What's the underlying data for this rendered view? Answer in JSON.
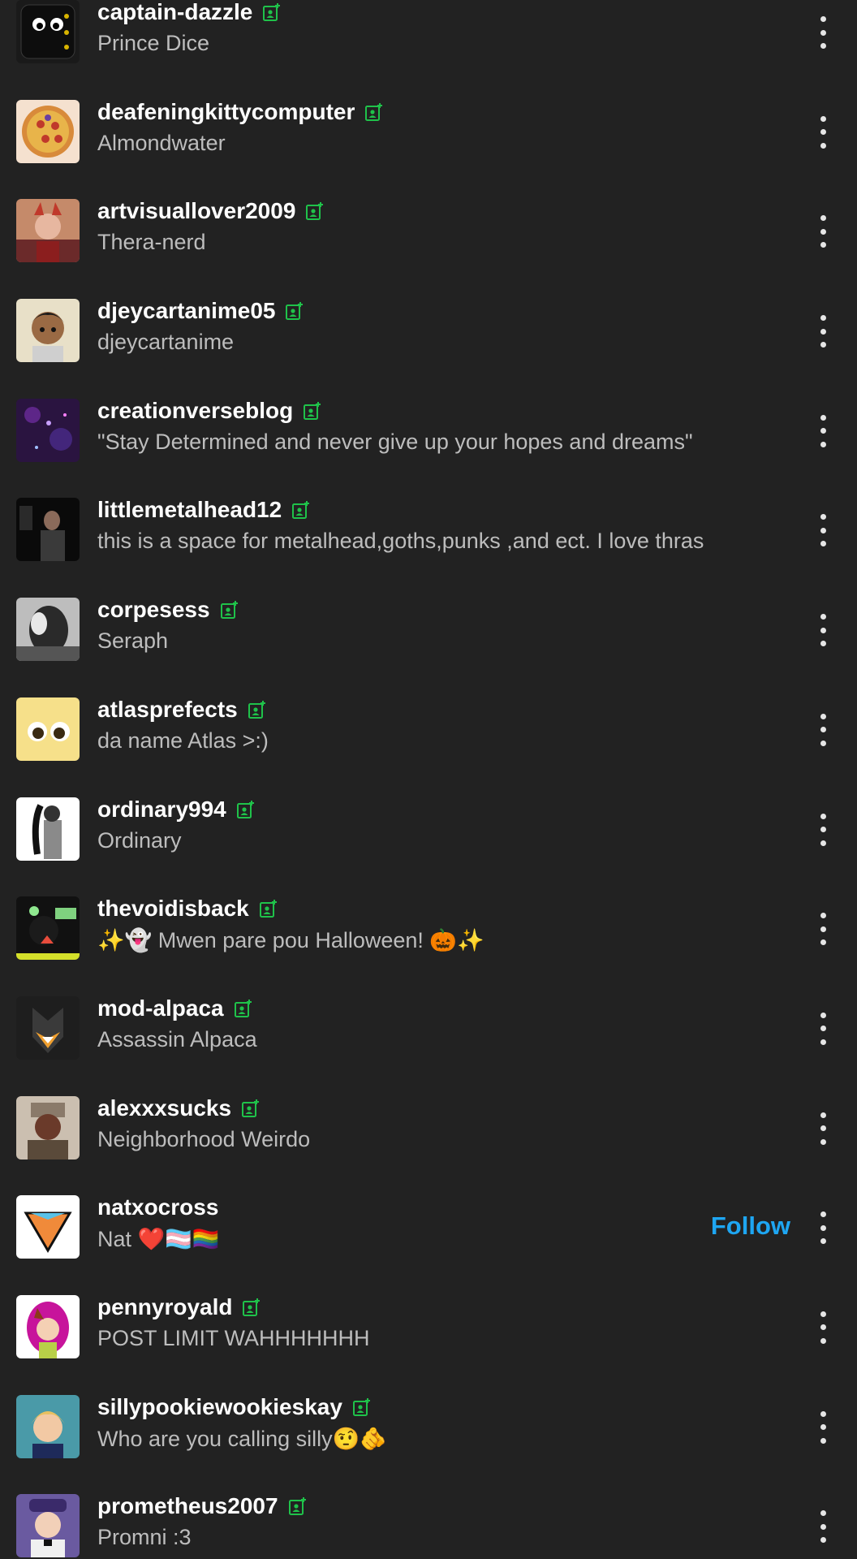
{
  "colors": {
    "background": "#222222",
    "username": "#ffffff",
    "subtitle": "#bdbdbd",
    "mutual_icon": "#1fc24a",
    "follow": "#1ea6f2"
  },
  "follow_label": "Follow",
  "rows": [
    {
      "username": "captain-dazzle",
      "subtitle": "Prince Dice",
      "mutual": true,
      "avatar": "dice"
    },
    {
      "username": "deafeningkittycomputer",
      "subtitle": "Almondwater",
      "mutual": true,
      "avatar": "pizza"
    },
    {
      "username": "artvisuallover2009",
      "subtitle": "Thera-nerd",
      "mutual": true,
      "avatar": "art"
    },
    {
      "username": "djeycartanime05",
      "subtitle": "djeycartanime",
      "mutual": true,
      "avatar": "boy"
    },
    {
      "username": "creationverseblog",
      "subtitle": "\"Stay Determined and never give up your hopes and dreams\"",
      "mutual": true,
      "avatar": "galaxy"
    },
    {
      "username": "littlemetalhead12",
      "subtitle": "this is a space for metalhead,goths,punks ,and ect. I love thras",
      "mutual": true,
      "avatar": "dark-photo"
    },
    {
      "username": "corpesess",
      "subtitle": "Seraph",
      "mutual": true,
      "avatar": "bw-photo"
    },
    {
      "username": "atlasprefects",
      "subtitle": "da name Atlas >:)",
      "mutual": true,
      "avatar": "emoji-face"
    },
    {
      "username": "ordinary994",
      "subtitle": "Ordinary",
      "mutual": true,
      "avatar": "sketch"
    },
    {
      "username": "thevoidisback",
      "subtitle": "✨👻 Mwen pare pou Halloween! 🎃✨",
      "mutual": true,
      "avatar": "void"
    },
    {
      "username": "mod-alpaca",
      "subtitle": "Assassin Alpaca",
      "mutual": true,
      "avatar": "alpaca"
    },
    {
      "username": "alexxxsucks",
      "subtitle": "Neighborhood Weirdo",
      "mutual": true,
      "avatar": "soldier"
    },
    {
      "username": "natxocross",
      "subtitle": "Nat ❤️🏳️‍⚧️🏳️‍🌈",
      "mutual": false,
      "avatar": "triangle",
      "follow": true
    },
    {
      "username": "pennyroyald",
      "subtitle": "POST LIMIT WAHHHHHHH",
      "mutual": true,
      "avatar": "pink"
    },
    {
      "username": "sillypookiewookieskay",
      "subtitle": "Who are you calling silly🤨🫵",
      "mutual": true,
      "avatar": "blonde"
    },
    {
      "username": "prometheus2007",
      "subtitle": "Promni :3",
      "mutual": true,
      "avatar": "purple-hat"
    }
  ]
}
